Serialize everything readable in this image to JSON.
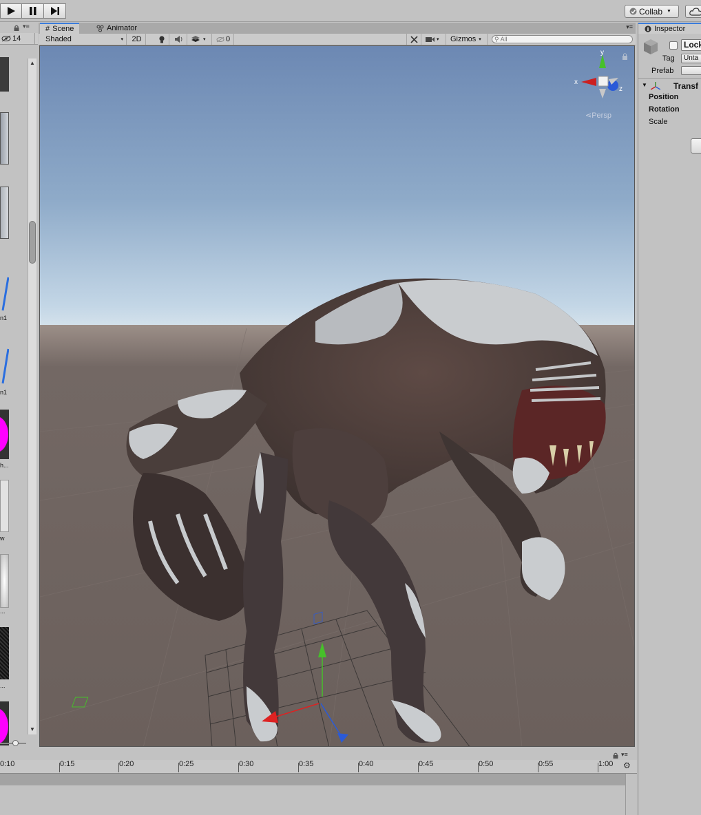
{
  "toolbar": {
    "collab_label": "Collab"
  },
  "project_panel": {
    "hidden_count": "14",
    "thumb_labels": [
      "n1",
      "n1",
      "h...",
      "w",
      "...",
      "..."
    ]
  },
  "scene_tabs": {
    "scene_label": "Scene",
    "animator_label": "Animator"
  },
  "scene_toolbar": {
    "shading_mode": "Shaded",
    "mode_2d": "2D",
    "hidden_count": "0",
    "gizmos_label": "Gizmos",
    "search_placeholder": "All"
  },
  "scene_view": {
    "projection_label": "Persp",
    "axis_labels": {
      "x": "x",
      "y": "y",
      "z": "z"
    }
  },
  "inspector": {
    "tab_label": "Inspector",
    "name_value": "Lock",
    "tag_label": "Tag",
    "tag_value": "Unta",
    "prefab_label": "Prefab",
    "component_title": "Transf",
    "position_label": "Position",
    "rotation_label": "Rotation",
    "scale_label": "Scale"
  },
  "timeline": {
    "ticks": [
      "0:10",
      "0:15",
      "0:20",
      "0:25",
      "0:30",
      "0:35",
      "0:40",
      "0:45",
      "0:50",
      "0:55",
      "1:00"
    ]
  },
  "colors": {
    "sky_top": "#6d8bb6",
    "horizon": "#c9d9e8",
    "ground": "#6f6561",
    "accent": "#3b7ddc",
    "magenta": "#ff00ff"
  }
}
